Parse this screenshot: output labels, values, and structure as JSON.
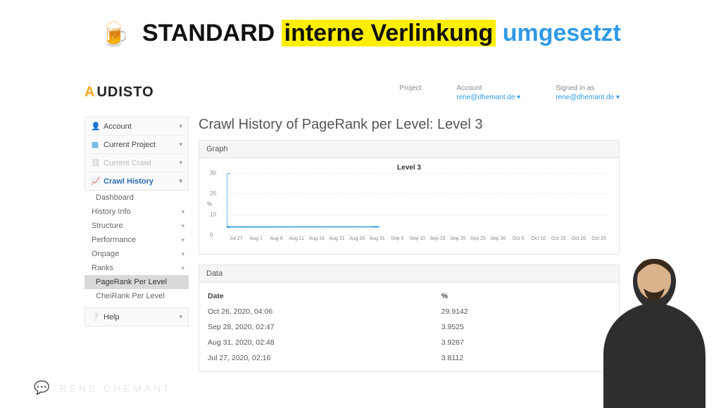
{
  "headline": {
    "part1": "STANDARD",
    "part2": "interne Verlinkung",
    "part3": "umgesetzt"
  },
  "logo": "UDISTO",
  "topnav": {
    "project_label": "Project",
    "account_label": "Account",
    "account_link": "rene@dhemant.de",
    "signed_label": "Signed in as",
    "signed_link": "rene@dhemant.de"
  },
  "sidebar": {
    "account": "Account",
    "current_project": "Current Project",
    "current_crawl": "Current Crawl",
    "crawl_history": "Crawl History",
    "dashboard": "Dashboard",
    "history_info": "History Info",
    "structure": "Structure",
    "performance": "Performance",
    "onpage": "Onpage",
    "ranks": "Ranks",
    "pagerank_per_level": "PageRank Per Level",
    "cheirank_per_level": "CheiRank Per Level",
    "help": "Help"
  },
  "page_title": "Crawl History of PageRank per Level: Level 3",
  "graph_panel": "Graph",
  "data_panel": "Data",
  "chart_data": {
    "type": "line",
    "title": "Level 3",
    "ylabel": "%",
    "ylim": [
      0,
      30
    ],
    "yticks": [
      0,
      10,
      20,
      30
    ],
    "xticks": [
      "Jul 27",
      "Aug 1",
      "Aug 6",
      "Aug 11",
      "Aug 16",
      "Aug 21",
      "Aug 26",
      "Aug 31",
      "Sep 5",
      "Sep 10",
      "Sep 15",
      "Sep 20",
      "Sep 25",
      "Sep 30",
      "Oct 5",
      "Oct 10",
      "Oct 15",
      "Oct 20",
      "Oct 25"
    ],
    "series": [
      {
        "name": "Level 3",
        "x": [
          "Jul 27",
          "Aug 31",
          "Sep 28",
          "Oct 26"
        ],
        "values": [
          3.8112,
          3.9287,
          3.9525,
          29.9142
        ]
      }
    ]
  },
  "table": {
    "headers": {
      "date": "Date",
      "pct": "%"
    },
    "rows": [
      {
        "date": "Oct 26, 2020, 04:06",
        "pct": "29.9142"
      },
      {
        "date": "Sep 28, 2020, 02:47",
        "pct": "3.9525"
      },
      {
        "date": "Aug 31, 2020, 02:48",
        "pct": "3.9287"
      },
      {
        "date": "Jul 27, 2020, 02:16",
        "pct": "3.8112"
      }
    ]
  },
  "watermark": "RENE DHEMANT"
}
